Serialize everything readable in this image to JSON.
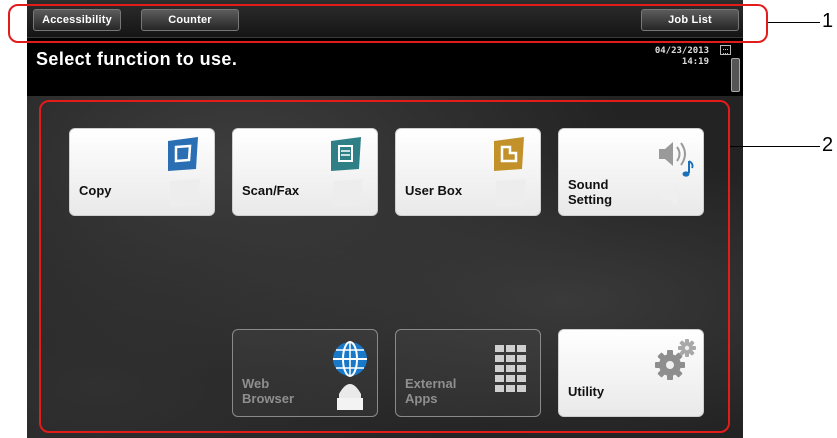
{
  "topbar": {
    "accessibility_label": "Accessibility",
    "counter_label": "Counter",
    "job_list_label": "Job List"
  },
  "header": {
    "title": "Select function to use.",
    "date": "04/23/2013",
    "time": "14:19"
  },
  "tiles": {
    "copy": "Copy",
    "scan_fax": "Scan/Fax",
    "user_box": "User Box",
    "sound_line1": "Sound",
    "sound_line2": "Setting",
    "web_line1": "Web",
    "web_line2": "Browser",
    "ext_line1": "External",
    "ext_line2": "Apps",
    "utility": "Utility"
  },
  "callouts": {
    "one": "1",
    "two": "2"
  },
  "colors": {
    "annotation_red": "#e31b1b",
    "copy_icon": "#2a6fb3",
    "scan_icon": "#2f7f86",
    "userbox_icon": "#c3912a",
    "web_globe": "#1a78c8"
  }
}
